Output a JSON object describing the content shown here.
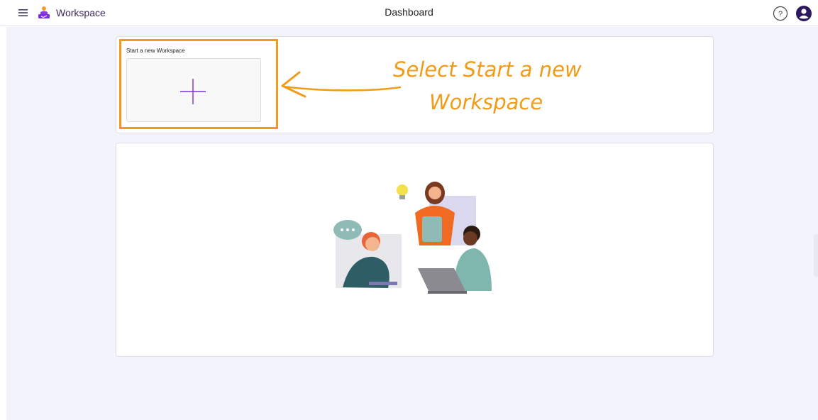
{
  "header": {
    "app_name": "Workspace",
    "page_title": "Dashboard",
    "help_icon": "question-circle-icon",
    "avatar_icon": "user-avatar-icon",
    "menu_icon": "hamburger-menu-icon",
    "logo_icon": "workspace-logo-icon"
  },
  "workspace_card": {
    "label": "Start a new Workspace",
    "tile_icon": "plus-icon"
  },
  "annotation": {
    "line1": "Select Start a new",
    "line2": "Workspace",
    "color": "#f29b18"
  },
  "colors": {
    "accent": "#7b2fe0",
    "brand_text": "#3a2a5a",
    "background": "#f3f3fb",
    "highlight": "#f29b18"
  }
}
